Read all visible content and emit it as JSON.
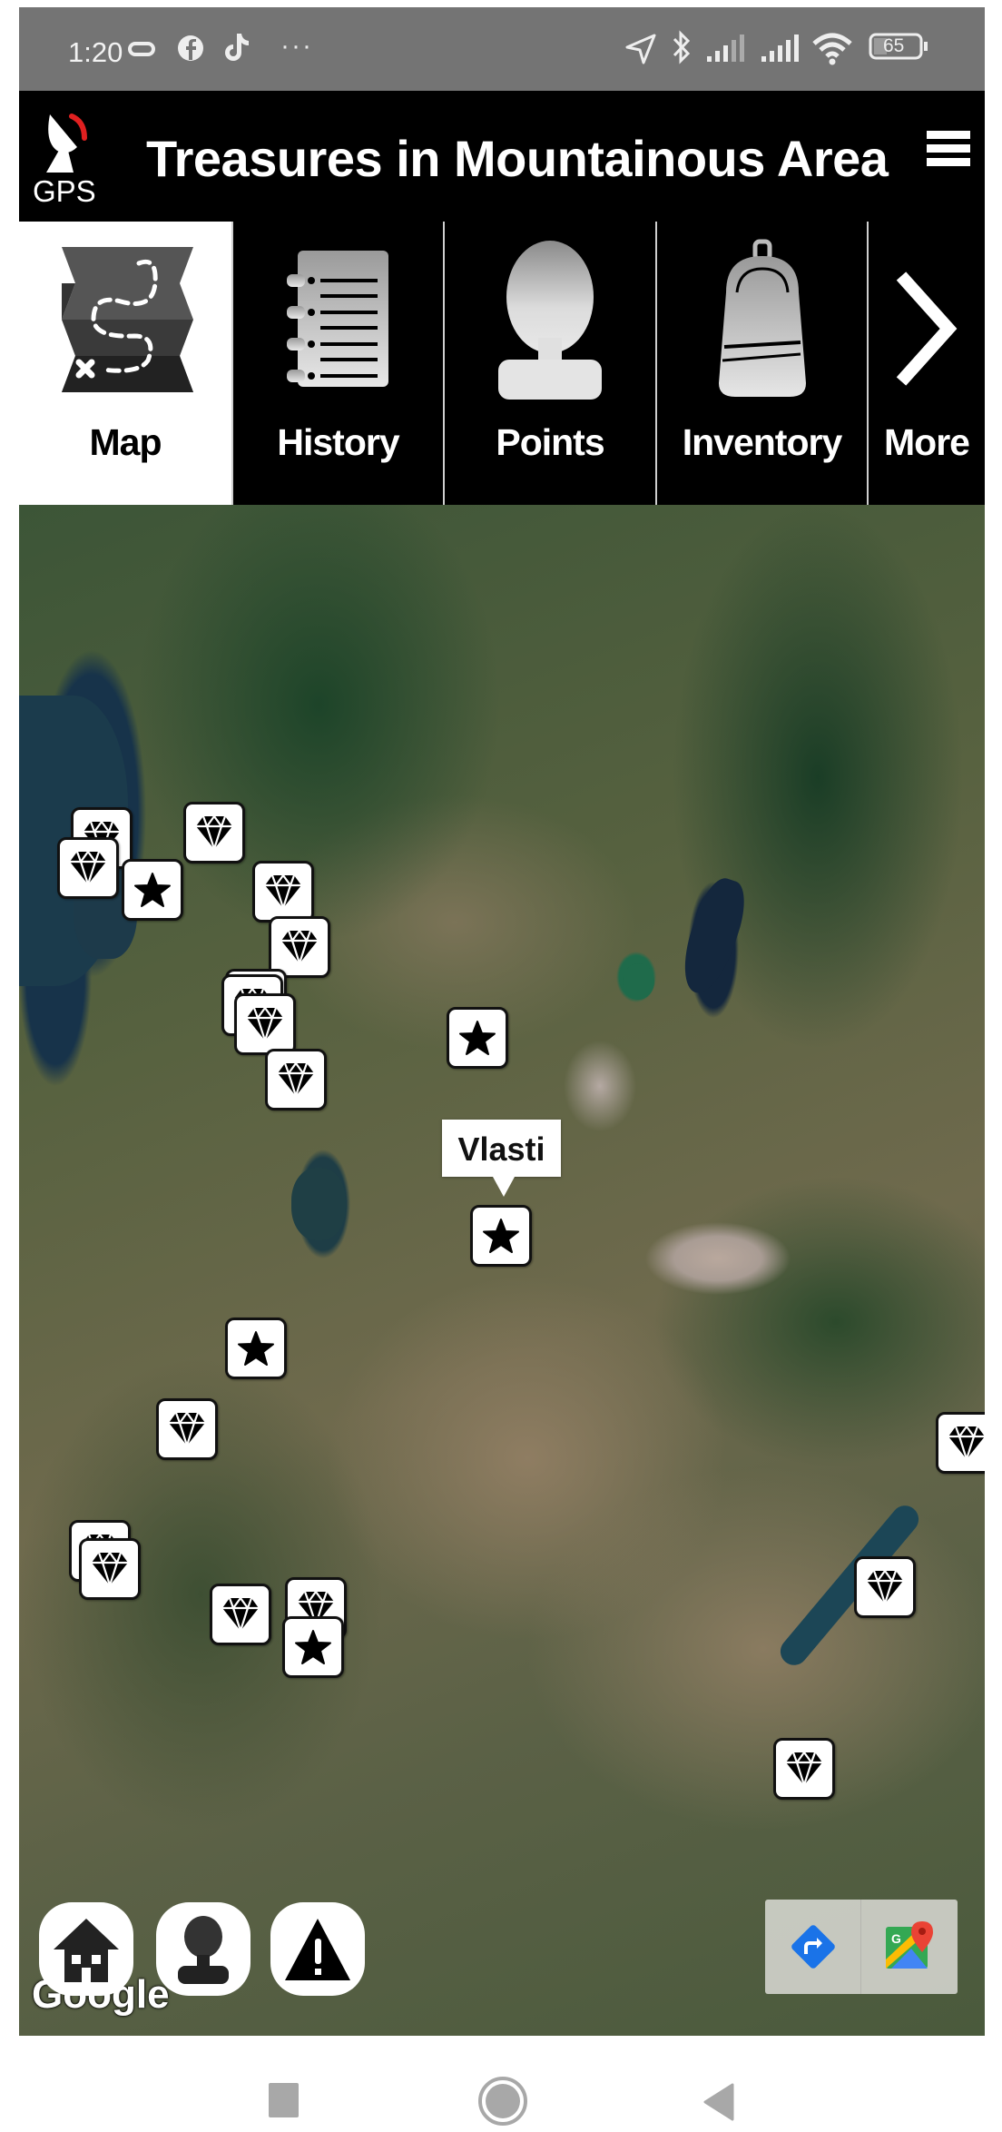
{
  "status_bar": {
    "time": "1:20",
    "left_icons": [
      "voicemail-icon",
      "facebook-icon",
      "tiktok-icon",
      "more-notifications-icon"
    ],
    "more_notifications": "···",
    "right_icons": [
      "location-icon",
      "bluetooth-icon",
      "signal-sim1-icon",
      "signal-sim2-icon",
      "wifi-icon",
      "battery-icon"
    ],
    "battery_level": "65"
  },
  "header": {
    "logo_label": "GPS",
    "title": "Treasures in Mountainous Area",
    "menu_icon": "hamburger-menu-icon"
  },
  "tabs": [
    {
      "label": "Map",
      "icon": "treasure-map-icon",
      "active": true
    },
    {
      "label": "History",
      "icon": "notebook-icon",
      "active": false
    },
    {
      "label": "Points",
      "icon": "person-icon",
      "active": false
    },
    {
      "label": "Inventory",
      "icon": "backpack-icon",
      "active": false
    },
    {
      "label": "More",
      "icon": "chevron-right-icon",
      "active": false
    }
  ],
  "map": {
    "type": "satellite",
    "attribution": "Google",
    "info_window": {
      "title": "Vlasti"
    },
    "markers": [
      {
        "kind": "treasure",
        "icon": "diamond-icon"
      },
      {
        "kind": "treasure",
        "icon": "diamond-icon"
      },
      {
        "kind": "treasure",
        "icon": "diamond-icon"
      },
      {
        "kind": "point",
        "icon": "star-icon"
      },
      {
        "kind": "treasure",
        "icon": "diamond-icon"
      },
      {
        "kind": "treasure",
        "icon": "diamond-icon"
      },
      {
        "kind": "point",
        "icon": "star-icon"
      },
      {
        "kind": "treasure",
        "icon": "diamond-icon"
      },
      {
        "kind": "treasure",
        "icon": "diamond-icon"
      },
      {
        "kind": "point",
        "icon": "star-icon"
      },
      {
        "kind": "point",
        "icon": "star-icon",
        "title": "Vlasti"
      },
      {
        "kind": "treasure",
        "icon": "diamond-icon"
      },
      {
        "kind": "point",
        "icon": "star-icon"
      },
      {
        "kind": "treasure",
        "icon": "diamond-icon"
      },
      {
        "kind": "treasure",
        "icon": "diamond-icon"
      },
      {
        "kind": "treasure",
        "icon": "diamond-icon"
      },
      {
        "kind": "treasure",
        "icon": "diamond-icon"
      },
      {
        "kind": "treasure",
        "icon": "diamond-icon"
      },
      {
        "kind": "point",
        "icon": "star-icon"
      },
      {
        "kind": "treasure",
        "icon": "diamond-icon"
      },
      {
        "kind": "treasure",
        "icon": "diamond-icon"
      },
      {
        "kind": "treasure",
        "icon": "diamond-icon"
      }
    ],
    "controls": {
      "home": "home-icon",
      "player": "person-icon",
      "alert": "warning-icon",
      "directions": "directions-icon",
      "open_in_maps": "google-maps-icon"
    }
  },
  "nav_bar": {
    "buttons": [
      "recents-button",
      "home-button",
      "back-button"
    ]
  },
  "colors": {
    "header_bg": "#000000",
    "status_bar_bg": "#747474",
    "active_tab_bg": "#ffffff",
    "gps_accent": "#e02020",
    "directions_blue": "#1a73e8"
  }
}
